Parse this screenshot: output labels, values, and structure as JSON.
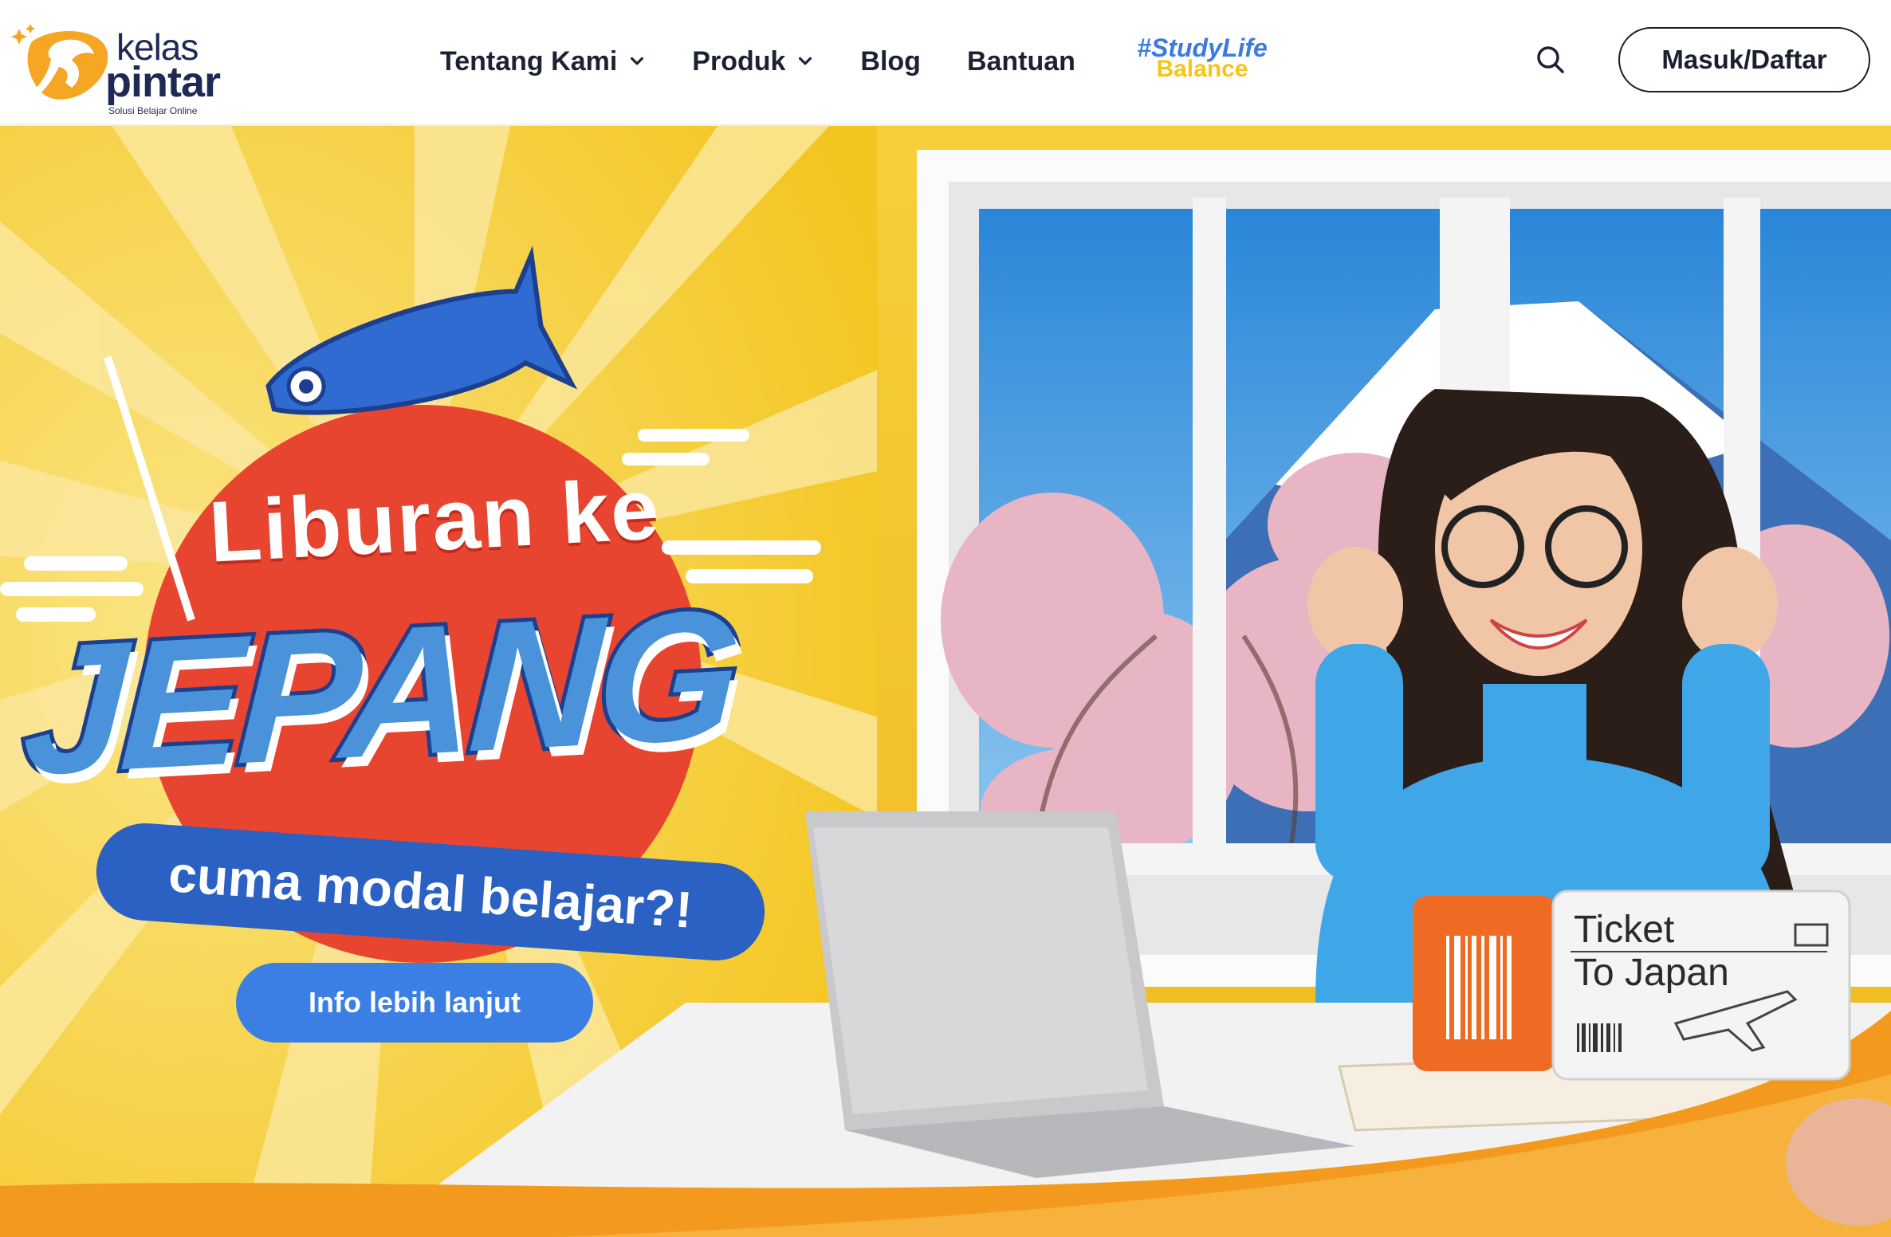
{
  "brand": {
    "name_top": "kelas",
    "name_bottom": "pintar",
    "tagline": "Solusi Belajar Online",
    "colors": {
      "navy": "#1e2a55",
      "yellow": "#f5a623",
      "blue": "#3b7ee4"
    }
  },
  "nav": {
    "items": [
      {
        "label": "Tentang Kami",
        "has_dropdown": true
      },
      {
        "label": "Produk",
        "has_dropdown": true
      },
      {
        "label": "Blog",
        "has_dropdown": false
      },
      {
        "label": "Bantuan",
        "has_dropdown": false
      }
    ],
    "campaign": {
      "line1": "#StudyLife",
      "line2": "Balance"
    },
    "search_icon": "search-icon",
    "login_label": "Masuk/Daftar"
  },
  "hero": {
    "headline_line1": "Liburan ke",
    "headline_line2": "JEPANG",
    "subheadline": "cuma modal belajar?!",
    "cta_label": "Info lebih lanjut",
    "ticket_text_line1": "Ticket",
    "ticket_text_line2": "To Japan"
  }
}
